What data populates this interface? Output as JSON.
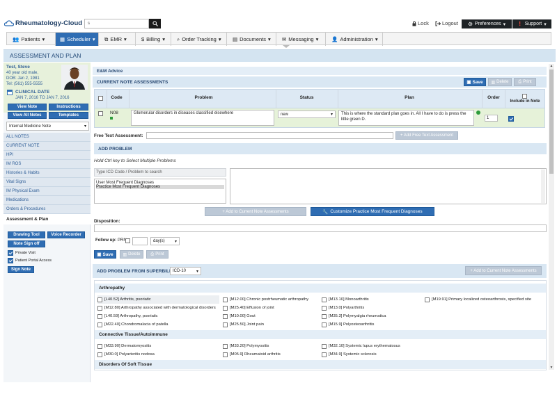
{
  "brand": {
    "name": "Rheumatology-Cloud"
  },
  "search": {
    "value": "s"
  },
  "top_links": {
    "lock": "Lock",
    "logout": "Logout",
    "preferences": "Preferences",
    "support": "Support"
  },
  "nav": [
    {
      "label": "Patients",
      "arrow": "▾"
    },
    {
      "label": "Scheduler",
      "arrow": "▾"
    },
    {
      "label": "EMR",
      "arrow": "▾"
    },
    {
      "label": "Billing",
      "arrow": "▾"
    },
    {
      "label": "Order Tracking",
      "arrow": "▾"
    },
    {
      "label": "Documents",
      "arrow": "▾"
    },
    {
      "label": "Messaging",
      "arrow": "▾"
    },
    {
      "label": "Administration",
      "arrow": "▾"
    }
  ],
  "page_title": "ASSESSMENT AND PLAN",
  "patient": {
    "name": "Test, Steve",
    "age_sex": "40 year old male,",
    "dob": "DOB: Jan 2, 1981",
    "tel": "Tel: (561) 555-5555",
    "clinical_date_label": "CLINICAL DATE",
    "clinical_date": "JAN 7, 2016 TO JAN 7, 2016"
  },
  "side_buttons": {
    "view_note": "View Note",
    "instructions": "Instructions",
    "view_all_notes": "View All Notes",
    "templates": "Templates"
  },
  "note_type": "Internal Medicine Note",
  "side_links": [
    "ALL NOTES",
    "CURRENT NOTE",
    "HPI",
    "IM ROS",
    "Histories & Habits",
    "Vital Signs",
    "IM Physical Exam",
    "Medications",
    "Orders & Procedures"
  ],
  "side_active": "Assessment & Plan",
  "side_tools": {
    "drawing_tool": "Drawing Tool",
    "voice_recorder": "Voice Recorder",
    "note_sign_off": "Note Sign off",
    "private_visit": "Private Visit",
    "patient_portal": "Patient Portal Access",
    "sign_note": "Sign Note"
  },
  "em_advice": "E&M Advice",
  "current": {
    "title": "CURRENT NOTE ASSESSMENTS",
    "save": "Save",
    "delete": "Delete",
    "print": "Print",
    "headers": {
      "code": "Code",
      "problem": "Problem",
      "status": "Status",
      "plan": "Plan",
      "order": "Order",
      "include": "Include in Note"
    },
    "row": {
      "code": "N08",
      "problem": "Glomerular disorders in diseases classified elsewhere",
      "status": "new",
      "plan": "This is where the standard plan goes in. All I have to do is press the little green D.",
      "order": "1"
    }
  },
  "free_text": {
    "label": "Free Text Assessment:",
    "button": "+ Add Free Text Assessment"
  },
  "add_problem": {
    "title": "ADD PROBLEM",
    "hint": "Hold Ctrl key to Select Multiple Problems",
    "placeholder": "Type ICD Code / Problem to search",
    "list": [
      "User Most Frequent Diagnoses",
      "Practice Most Frequent Diagnoses"
    ],
    "add_button": "+ Add to Current Note Assessments",
    "customize_button": "Customize Practice Most Frequent Diagnoses"
  },
  "disposition": {
    "label": "Disposition:"
  },
  "followup": {
    "label": "Follow up:",
    "prn": "PRN",
    "unit": "day(s)",
    "save": "Save",
    "delete": "Delete",
    "print": "Print"
  },
  "superbill": {
    "title": "ADD PROBLEM FROM SUPERBILL",
    "code_set": "ICD-10",
    "add_button": "+ Add to Current Note Assessments",
    "groups": [
      {
        "name": "Arthropathy",
        "items": [
          "[L40.52] Arthritis, psoriatic",
          "[M12.00] Chronic postrheumatic arthropathy",
          "[M13.10] Monoarthritis",
          "[M19.91] Primary localized osteoarthrosis, specified site",
          "[M12.80] Arthropathy associated with dermatological disorders",
          "[M25.40] Effusion of joint",
          "[M13.0] Polyarthritis",
          "[L40.59] Arthropathy, psoriatic",
          "[M10.00] Gout",
          "[M35.3] Polymyalgia rheumatica",
          "[M22.40] Chondromalacia of patella",
          "[M25.50] Joint pain",
          "[M15.9] Polyosteoarthritis"
        ]
      },
      {
        "name": "Connective Tissue/Autoimmune",
        "items": [
          "[M33.90] Dermatomyositis",
          "[M33.20] Polymyositis",
          "[M32.10] Systemic lupus erythematosus",
          "[M30.0] Polyarteritis nodosa",
          "[M05.9] Rheumatoid arthritis",
          "[M34.9] Systemic sclerosis"
        ]
      },
      {
        "name": "Disorders Of Soft Tissue",
        "items": []
      }
    ]
  },
  "colors": {
    "accent": "#2f6db3",
    "nav_active": "#2f6db3",
    "section": "#d9e7f3",
    "row_green": "#e6f2d9"
  }
}
